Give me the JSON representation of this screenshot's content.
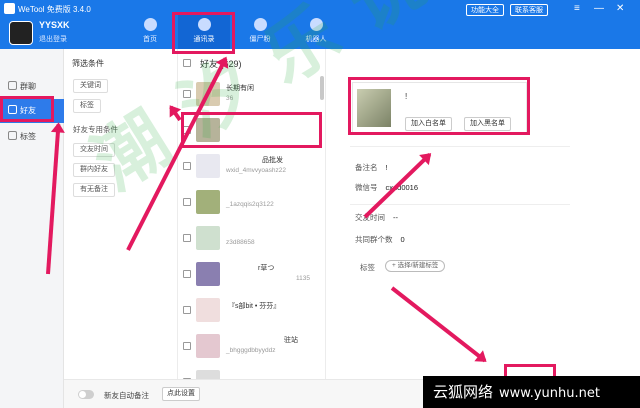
{
  "app": {
    "title": "WeTool 免费版 3.4.0",
    "nickname": "YYSXK",
    "logout": "退出登录",
    "btn_features": "功能大全",
    "btn_contact": "联系客服"
  },
  "nav": [
    {
      "label": "首页",
      "icon": "home-icon"
    },
    {
      "label": "通讯录",
      "icon": "contacts-icon"
    },
    {
      "label": "僵尸粉",
      "icon": "zombie-icon"
    },
    {
      "label": "机器人",
      "icon": "robot-icon"
    }
  ],
  "sidebar": [
    {
      "label": "群聊",
      "icon": "group-chat-icon"
    },
    {
      "label": "好友",
      "icon": "friend-icon"
    },
    {
      "label": "标签",
      "icon": "tag-icon"
    }
  ],
  "filters": {
    "title": "筛选条件",
    "keyword": "关键词",
    "tag": "标签",
    "friend_title": "好友专用条件",
    "added_time": "交友时间",
    "in_group": "群内好友",
    "has_note": "有无备注"
  },
  "friends": {
    "header": "好友 (629)",
    "rows": [
      {
        "name": "长期有闲",
        "sub": "36"
      },
      {
        "name": "",
        "sub": ""
      },
      {
        "name": "品批发",
        "sub": "wxid_4mvvyoashz22"
      },
      {
        "name": "",
        "sub": "_1azqqis2q3122"
      },
      {
        "name": "",
        "sub": "z3d88658"
      },
      {
        "name": "r草つ",
        "sub": "1135"
      },
      {
        "name": "『s部bit • 芬芬』",
        "sub": ""
      },
      {
        "name": "驻站",
        "sub": "_bhgggdbbyyddz"
      },
      {
        "name": "",
        "sub": ""
      }
    ]
  },
  "detail": {
    "name": "!",
    "btn_white": "加入白名单",
    "btn_black": "加入黑名单",
    "note_label": "备注名",
    "note_value": "!",
    "wxid_label": "微信号",
    "wxid_value": "cxdd0016",
    "added_label": "交友时间",
    "added_value": "--",
    "groups_label": "共同群个数",
    "groups_value": "0",
    "tags_label": "标签",
    "tag_button": "+ 选择/新建标签"
  },
  "bottom": {
    "auto_note": "新友自动备注",
    "settings": "点此设置"
  },
  "watermark": "潮 汐 乐 说 园",
  "site": {
    "name": "云狐网络",
    "url": "www.yunhu.net"
  },
  "colors": {
    "primary": "#1a78e8",
    "highlight": "#e3195f",
    "selected": "#2e7bea"
  }
}
